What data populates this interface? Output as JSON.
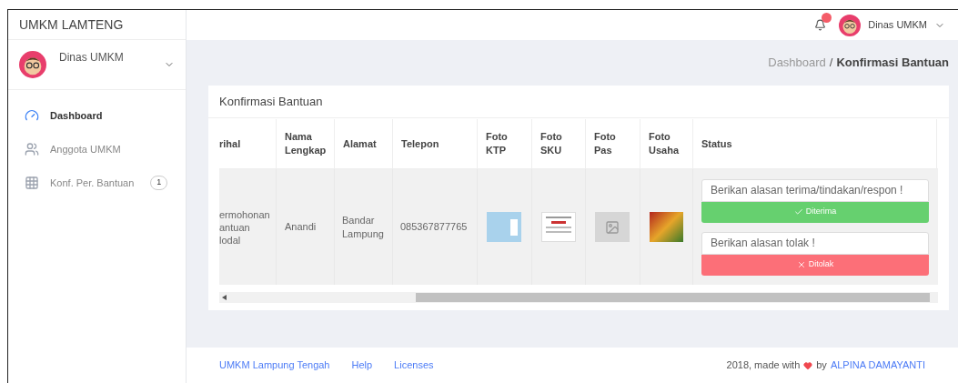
{
  "brand": "UMKM LAMTENG",
  "sidebar": {
    "user": {
      "name": "Dinas UMKM"
    },
    "items": [
      {
        "label": "Dashboard",
        "selected": true
      },
      {
        "label": "Anggota UMKM",
        "selected": false
      },
      {
        "label": "Konf. Per. Bantuan",
        "selected": false,
        "badge": "1"
      }
    ]
  },
  "topbar": {
    "notification": true,
    "user": "Dinas UMKM"
  },
  "breadcrumb": {
    "parent": "Dashboard",
    "separator": "/",
    "current": "Konfirmasi Bantuan"
  },
  "card": {
    "title": "Konfirmasi Bantuan",
    "table": {
      "columns": [
        "rihal",
        "Nama Lengkap",
        "Alamat",
        "Telepon",
        "Foto KTP",
        "Foto SKU",
        "Foto Pas",
        "Foto Usaha",
        "Status"
      ],
      "rows": [
        {
          "perihal": "ermohonan\nantuan\nlodal",
          "nama": "Anandi",
          "alamat": "Bandar Lampung",
          "telepon": "085367877765",
          "photos": [
            {
              "kind": "id-card"
            },
            {
              "kind": "document"
            },
            {
              "kind": "empty"
            },
            {
              "kind": "photo"
            }
          ],
          "accept": {
            "placeholder": "Berikan alasan terima/tindakan/respon !",
            "button": "Diterima"
          },
          "reject": {
            "placeholder": "Berikan alasan tolak !",
            "button": "Ditolak"
          }
        }
      ]
    }
  },
  "footer": {
    "links": [
      "UMKM Lampung Tengah",
      "Help",
      "Licenses"
    ],
    "credit": "2018, made with",
    "by": "by",
    "author": "ALPINA DAMAYANTI"
  }
}
